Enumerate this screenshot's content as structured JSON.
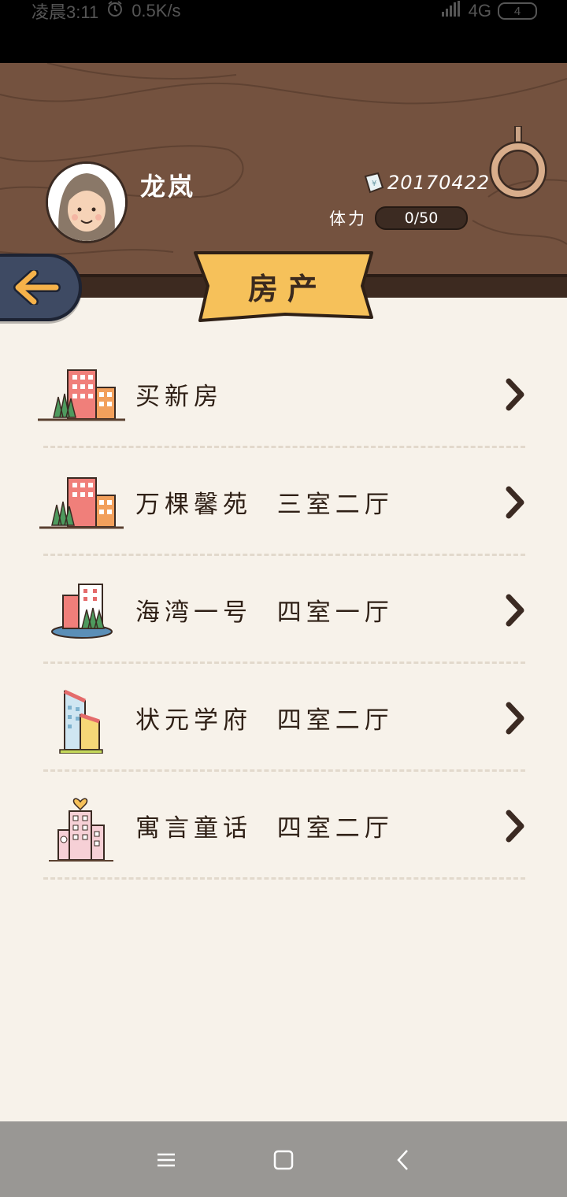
{
  "status_bar": {
    "time": "凌晨3:11",
    "network_speed": "0.5K/s",
    "signal": "4G",
    "battery": "4"
  },
  "profile": {
    "name": "龙岚",
    "money": "20170422",
    "stamina_label": "体力",
    "stamina_value": "0/50"
  },
  "page": {
    "title": "房产"
  },
  "properties": [
    {
      "label": "买新房",
      "icon": "buy-new-house-icon"
    },
    {
      "label": "万棵馨苑  三室二厅",
      "icon": "apartment-trees-icon"
    },
    {
      "label": "海湾一号  四室一厅",
      "icon": "bay-apartment-icon"
    },
    {
      "label": "状元学府  四室二厅",
      "icon": "school-apartment-icon"
    },
    {
      "label": "寓言童话  四室二厅",
      "icon": "fairy-tale-apartment-icon"
    }
  ],
  "colors": {
    "wood": "#74523f",
    "background": "#f7f2ea",
    "banner": "#f6c15a",
    "back_button": "#3e4a63",
    "arrow": "#3b2a22"
  }
}
